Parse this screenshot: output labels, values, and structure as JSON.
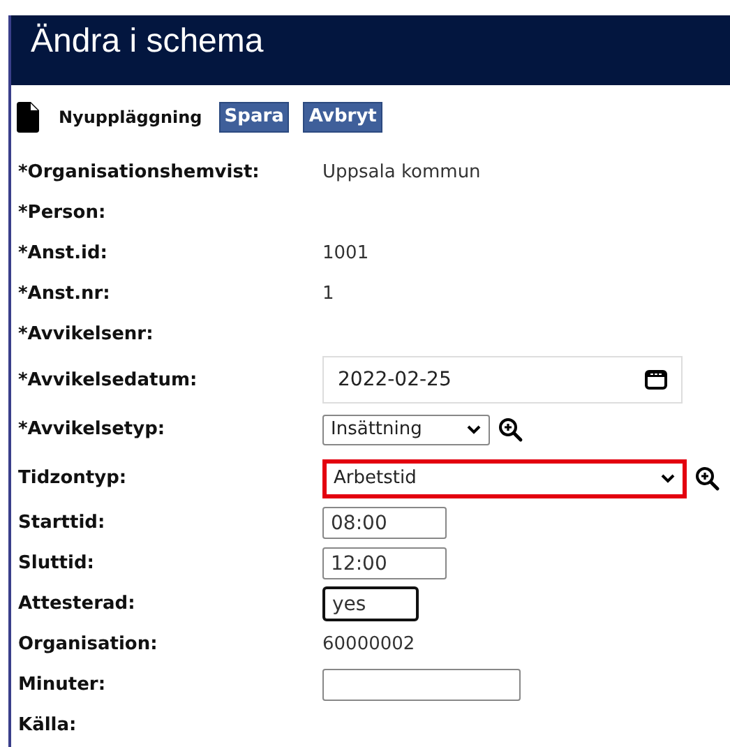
{
  "window": {
    "title": "Ändra i schema"
  },
  "toolbar": {
    "title": "Nyuppläggning",
    "buttons": [
      "Spara",
      "Avbryt"
    ]
  },
  "fields": [
    {
      "kind": "text",
      "label": "*Organisationshemvist:",
      "value": "Uppsala kommun"
    },
    {
      "kind": "text",
      "label": "*Person:"
    },
    {
      "kind": "text",
      "label": "*Anst.id:",
      "value": "1001"
    },
    {
      "kind": "text",
      "label": "*Anst.nr:",
      "value": "1"
    },
    {
      "kind": "text",
      "label": "*Avvikelsenr:"
    },
    {
      "kind": "date",
      "label": "*Avvikelsedatum:",
      "value": "2022-02-25"
    },
    {
      "kind": "short-select",
      "label": "*Avvikelsetyp:",
      "value": "Insättning",
      "lookup": true,
      "highlighted": false
    },
    {
      "kind": "long-select",
      "label": "Tidzontyp:",
      "value": "Arbetstid",
      "lookup": true,
      "highlighted": true
    },
    {
      "kind": "time-input",
      "label": "Starttid:",
      "value": "08:00",
      "focused": false
    },
    {
      "kind": "time-input",
      "label": "Sluttid:",
      "value": "12:00",
      "focused": false
    },
    {
      "kind": "short-input",
      "label": "Attesterad:",
      "value": "yes",
      "focused": true
    },
    {
      "kind": "text",
      "label": "Organisation:",
      "value": "60000002"
    },
    {
      "kind": "number-input",
      "label": "Minuter:",
      "focused": false
    },
    {
      "kind": "text",
      "label": "Källa:"
    }
  ]
}
